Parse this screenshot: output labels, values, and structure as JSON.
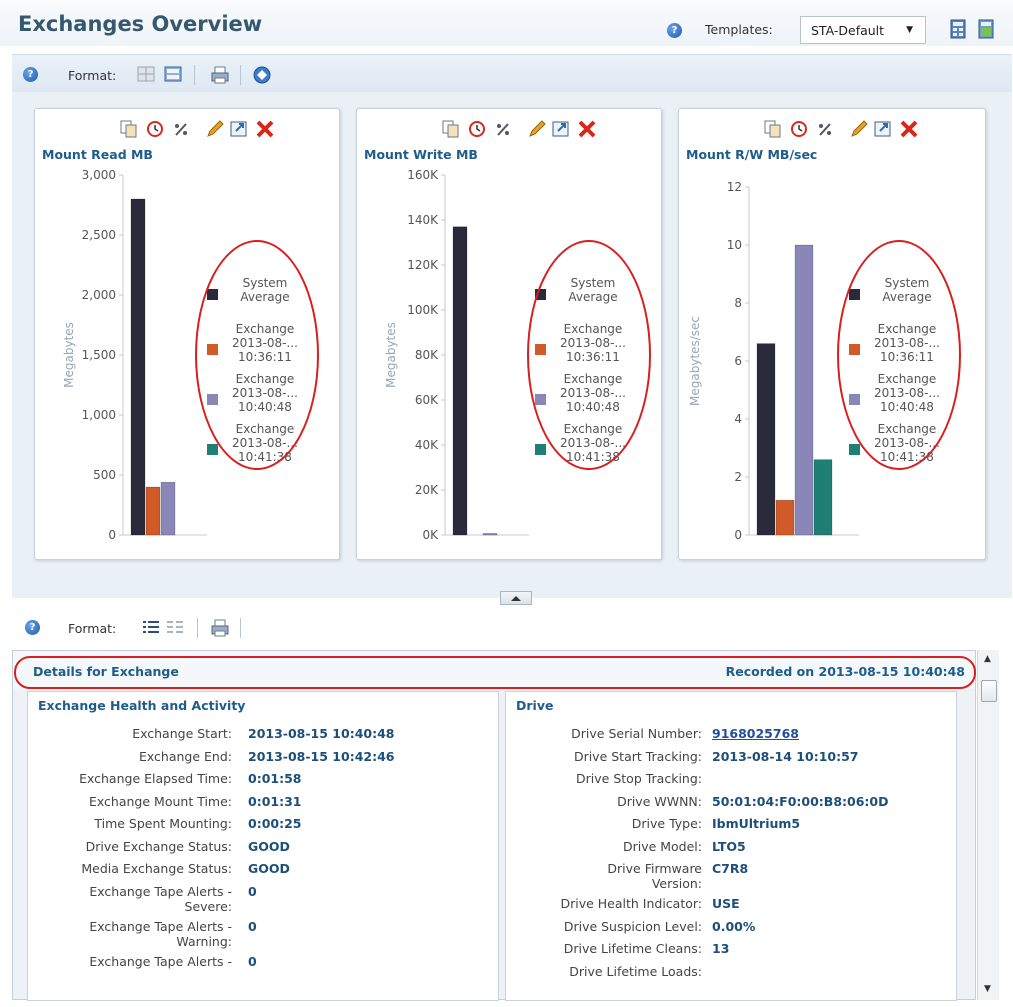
{
  "header": {
    "title": "Exchanges Overview",
    "templates_label": "Templates:",
    "templates_value": "STA-Default"
  },
  "toolbar": {
    "format_label": "Format:"
  },
  "lower_toolbar": {
    "format_label": "Format:"
  },
  "charts": [
    {
      "title": "Mount Read MB",
      "ylabel": "Megabytes",
      "ticks": [
        "3,000",
        "2,500",
        "2,000",
        "1,500",
        "1,000",
        "500",
        "0"
      ],
      "ymax": 3000
    },
    {
      "title": "Mount Write MB",
      "ylabel": "Megabytes",
      "ticks": [
        "160K",
        "140K",
        "120K",
        "100K",
        "80K",
        "60K",
        "40K",
        "20K",
        "0K"
      ],
      "ymax": 160000
    },
    {
      "title": "Mount R/W MB/sec",
      "ylabel": "Megabytes/sec",
      "ticks": [
        "12",
        "10",
        "8",
        "6",
        "4",
        "2",
        "0"
      ],
      "ymax": 12
    }
  ],
  "chart_data": [
    {
      "type": "bar",
      "title": "Mount Read MB",
      "ylabel": "Megabytes",
      "ylim": [
        0,
        3000
      ],
      "legend": "right",
      "series": [
        {
          "name": "System Average",
          "values": [
            2800
          ]
        },
        {
          "name": "Exchange 2013-08-... 10:36:11",
          "values": [
            400
          ]
        },
        {
          "name": "Exchange 2013-08-... 10:40:48",
          "values": [
            440
          ]
        },
        {
          "name": "Exchange 2013-08-... 10:41:38",
          "values": [
            0
          ]
        }
      ]
    },
    {
      "type": "bar",
      "title": "Mount Write MB",
      "ylabel": "Megabytes",
      "ylim": [
        0,
        160000
      ],
      "legend": "right",
      "series": [
        {
          "name": "System Average",
          "values": [
            137000
          ]
        },
        {
          "name": "Exchange 2013-08-... 10:36:11",
          "values": [
            0
          ]
        },
        {
          "name": "Exchange 2013-08-... 10:40:48",
          "values": [
            700
          ]
        },
        {
          "name": "Exchange 2013-08-... 10:41:38",
          "values": [
            0
          ]
        }
      ]
    },
    {
      "type": "bar",
      "title": "Mount R/W MB/sec",
      "ylabel": "Megabytes/sec",
      "ylim": [
        0,
        12
      ],
      "legend": "right",
      "series": [
        {
          "name": "System Average",
          "values": [
            6.6
          ]
        },
        {
          "name": "Exchange 2013-08-... 10:36:11",
          "values": [
            1.2
          ]
        },
        {
          "name": "Exchange 2013-08-... 10:40:48",
          "values": [
            10
          ]
        },
        {
          "name": "Exchange 2013-08-... 10:41:38",
          "values": [
            2.6
          ]
        }
      ]
    }
  ],
  "legend_items": [
    {
      "line1": "System",
      "line2": "Average",
      "line3": "",
      "color": "#2a2a3a"
    },
    {
      "line1": "Exchange",
      "line2": "2013-08-...",
      "line3": "10:36:11",
      "color": "#d05a28"
    },
    {
      "line1": "Exchange",
      "line2": "2013-08-...",
      "line3": "10:40:48",
      "color": "#8a87b8"
    },
    {
      "line1": "Exchange",
      "line2": "2013-08-...",
      "line3": "10:41:38",
      "color": "#1f7f74"
    }
  ],
  "details": {
    "title": "Details for Exchange",
    "recorded": "Recorded on 2013-08-15 10:40:48",
    "left_panel": {
      "title": "Exchange Health and Activity",
      "rows": [
        {
          "label": "Exchange Start:",
          "label2": "",
          "value": "2013-08-15 10:40:48"
        },
        {
          "label": "Exchange End:",
          "label2": "",
          "value": "2013-08-15 10:42:46"
        },
        {
          "label": "Exchange Elapsed Time:",
          "label2": "",
          "value": "0:01:58"
        },
        {
          "label": "Exchange Mount Time:",
          "label2": "",
          "value": "0:01:31"
        },
        {
          "label": "Time Spent Mounting:",
          "label2": "",
          "value": "0:00:25"
        },
        {
          "label": "Drive Exchange Status:",
          "label2": "",
          "value": "GOOD"
        },
        {
          "label": "Media Exchange Status:",
          "label2": "",
          "value": "GOOD"
        },
        {
          "label": "Exchange Tape Alerts -",
          "label2": "Severe:",
          "value": "0"
        },
        {
          "label": "Exchange Tape Alerts -",
          "label2": "Warning:",
          "value": "0"
        },
        {
          "label": "Exchange Tape Alerts -",
          "label2": "",
          "value": "0"
        }
      ]
    },
    "right_panel": {
      "title": "Drive",
      "rows": [
        {
          "label": "Drive Serial Number:",
          "label2": "",
          "value": "9168025768",
          "link": true
        },
        {
          "label": "Drive Start Tracking:",
          "label2": "",
          "value": "2013-08-14 10:10:57"
        },
        {
          "label": "Drive Stop Tracking:",
          "label2": "",
          "value": ""
        },
        {
          "label": "Drive WWNN:",
          "label2": "",
          "value": "50:01:04:F0:00:B8:06:0D"
        },
        {
          "label": "Drive Type:",
          "label2": "",
          "value": "IbmUltrium5"
        },
        {
          "label": "Drive Model:",
          "label2": "",
          "value": "LTO5"
        },
        {
          "label": "Drive Firmware",
          "label2": "Version:",
          "value": "C7R8"
        },
        {
          "label": "Drive Health Indicator:",
          "label2": "",
          "value": "USE"
        },
        {
          "label": "Drive Suspicion Level:",
          "label2": "",
          "value": "0.00%"
        },
        {
          "label": "Drive Lifetime Cleans:",
          "label2": "",
          "value": "13"
        },
        {
          "label": "Drive Lifetime Loads:",
          "label2": "",
          "value": ""
        }
      ]
    }
  },
  "colors": {
    "title": "#35586e",
    "link": "#1e5d8b",
    "annotation_red": "#d81e1e"
  }
}
